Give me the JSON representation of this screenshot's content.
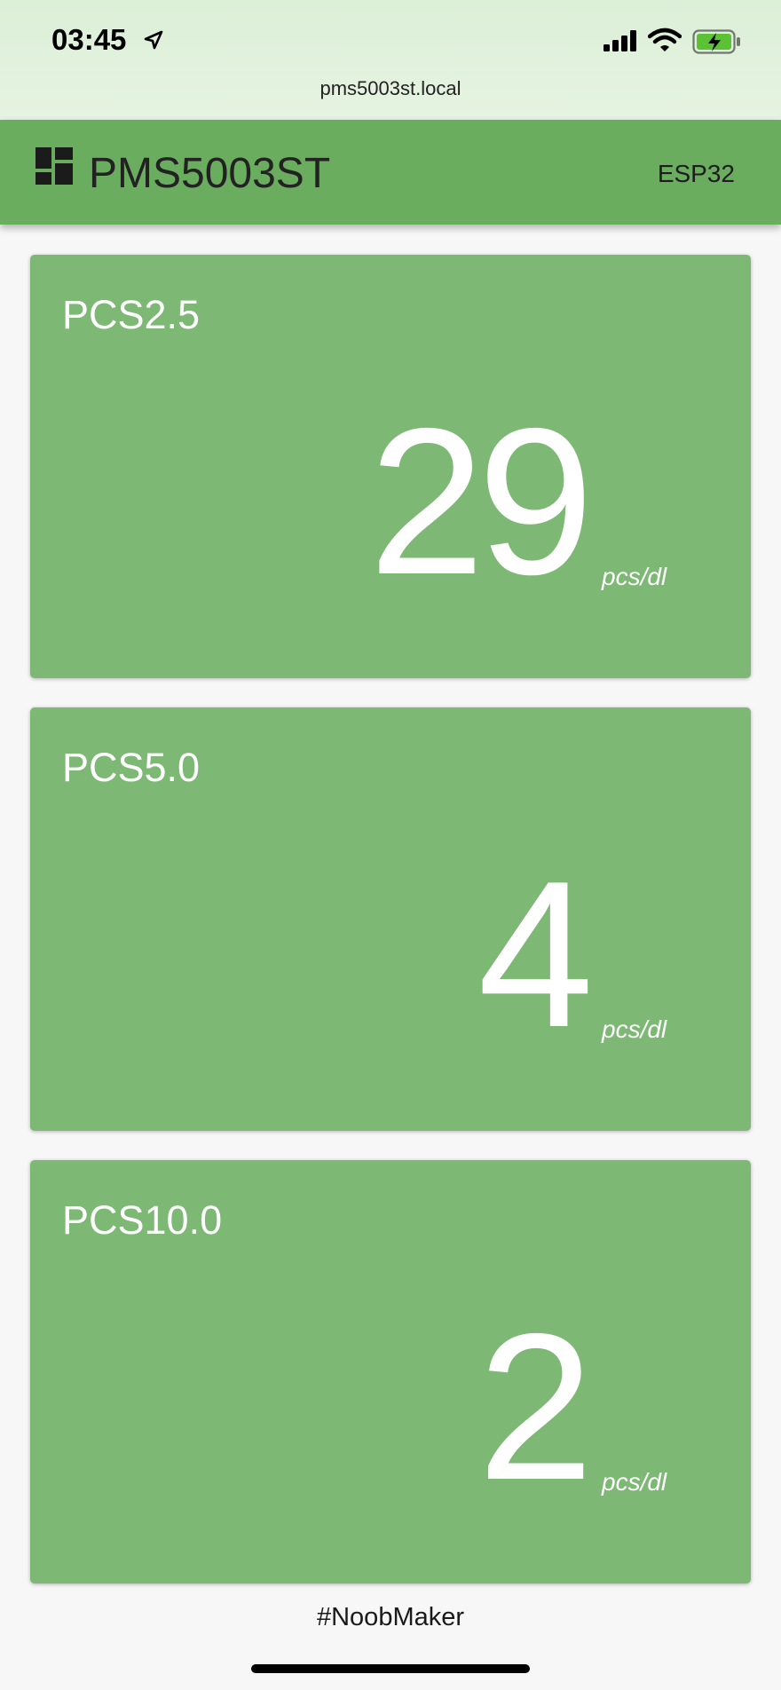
{
  "status_bar": {
    "time": "03:45",
    "url": "pms5003st.local",
    "icons": [
      "location-arrow-icon",
      "signal-icon",
      "wifi-icon",
      "battery-charging-icon"
    ]
  },
  "app_bar": {
    "icon": "dashboard-icon",
    "title": "PMS5003ST",
    "device": "ESP32",
    "color": "#6aad5f"
  },
  "cards": [
    {
      "label": "PCS2.5",
      "value": "29",
      "unit": "pcs/dl"
    },
    {
      "label": "PCS5.0",
      "value": "4",
      "unit": "pcs/dl"
    },
    {
      "label": "PCS10.0",
      "value": "2",
      "unit": "pcs/dl"
    }
  ],
  "card_color": "#7db875",
  "footer": {
    "text": "#NoobMaker"
  }
}
